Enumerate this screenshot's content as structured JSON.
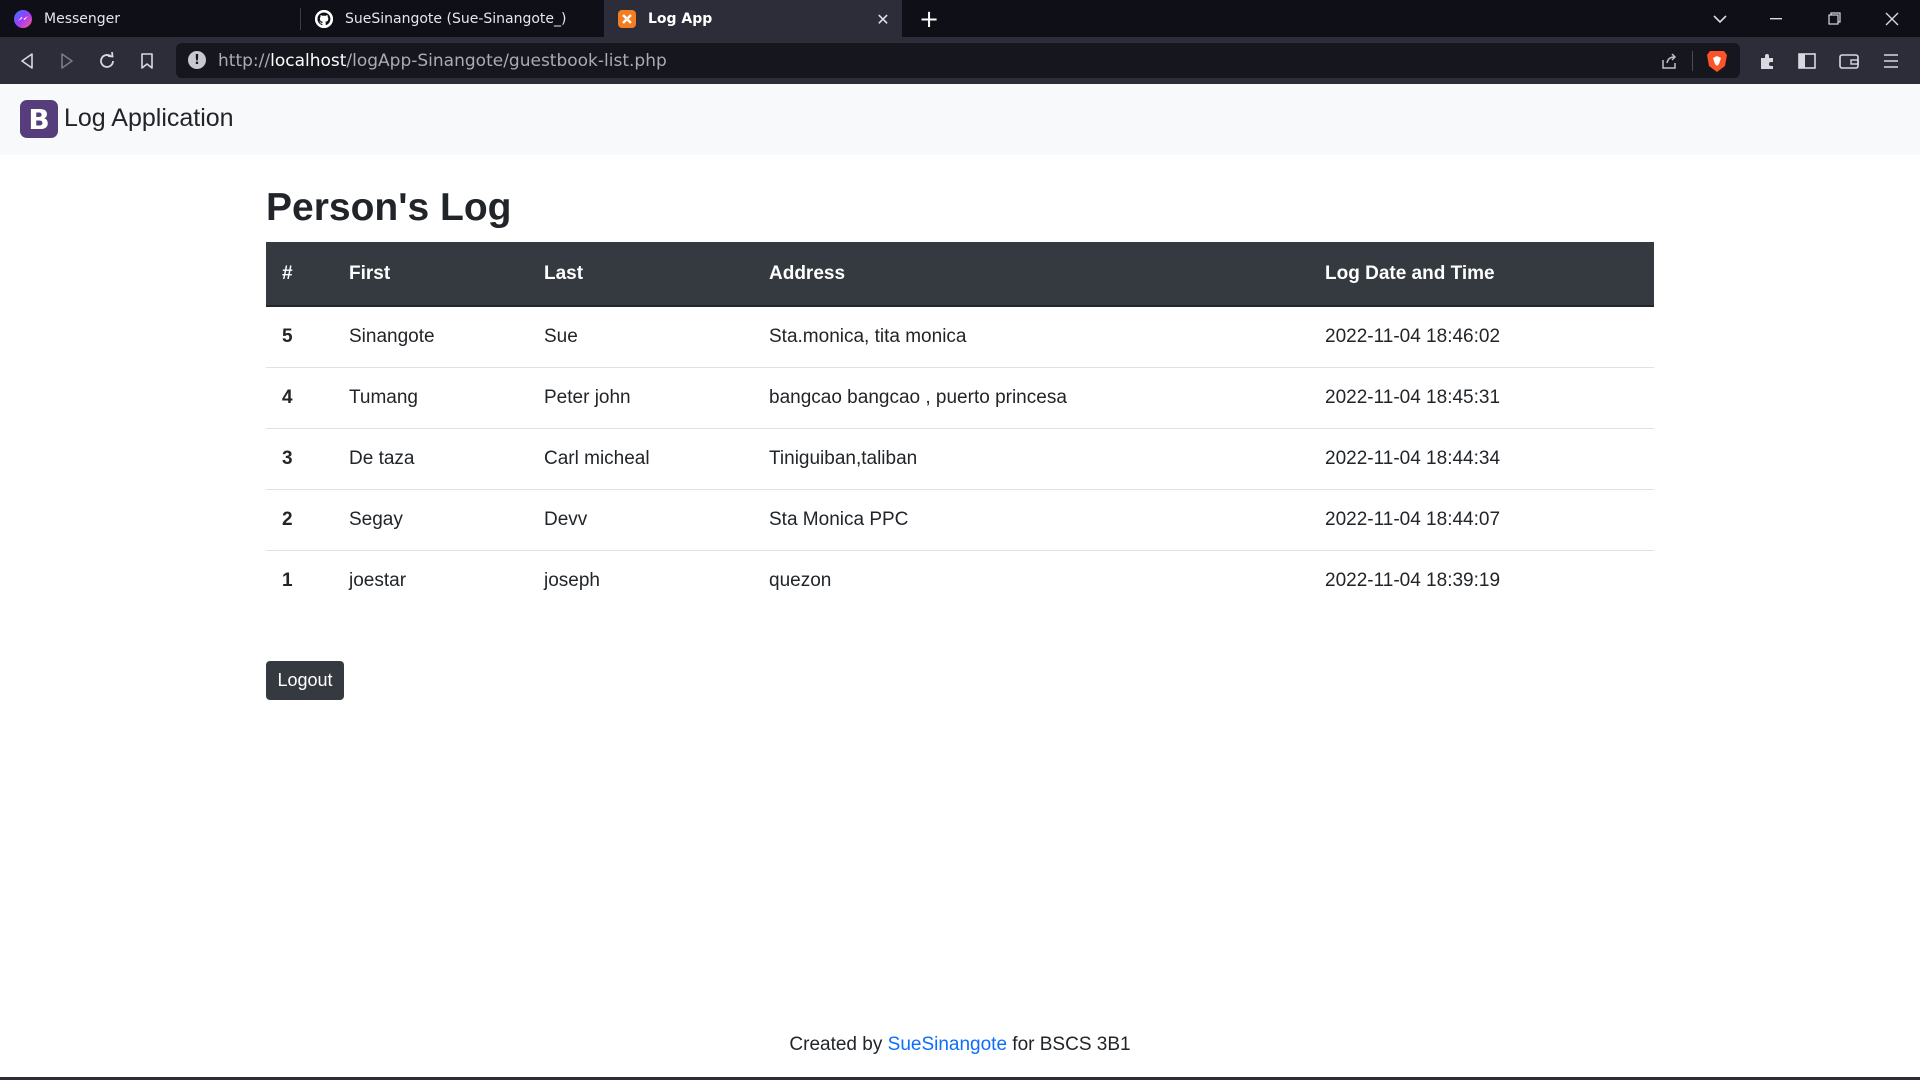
{
  "browser": {
    "tabs": [
      {
        "label": "Messenger",
        "icon": "messenger-icon"
      },
      {
        "label": "SueSinangote (Sue-Sinangote_)",
        "icon": "github-icon"
      },
      {
        "label": "Log App",
        "icon": "xampp-icon",
        "active": true
      }
    ],
    "url_prefix": "http://",
    "url_host": "localhost",
    "url_path": "/logApp-Sinangote/guestbook-list.php"
  },
  "app": {
    "brand_letter": "B",
    "brand_name": "Log Application",
    "brand_color": "#563d7c"
  },
  "main": {
    "title": "Person's Log",
    "table": {
      "headers": [
        "#",
        "First",
        "Last",
        "Address",
        "Log Date and Time"
      ],
      "rows": [
        {
          "id": "5",
          "first": "Sinangote",
          "last": "Sue",
          "address": "Sta.monica, tita monica",
          "datetime": "2022-11-04 18:46:02"
        },
        {
          "id": "4",
          "first": "Tumang",
          "last": "Peter john",
          "address": "bangcao bangcao , puerto princesa",
          "datetime": "2022-11-04 18:45:31"
        },
        {
          "id": "3",
          "first": "De taza",
          "last": "Carl micheal",
          "address": "Tiniguiban,taliban",
          "datetime": "2022-11-04 18:44:34"
        },
        {
          "id": "2",
          "first": "Segay",
          "last": "Devv",
          "address": "Sta Monica PPC",
          "datetime": "2022-11-04 18:44:07"
        },
        {
          "id": "1",
          "first": "joestar",
          "last": "joseph",
          "address": "quezon",
          "datetime": "2022-11-04 18:39:19"
        }
      ]
    },
    "logout_label": "Logout"
  },
  "footer": {
    "prefix": "Created by ",
    "link": "SueSinangote",
    "suffix": " for BSCS 3B1"
  }
}
